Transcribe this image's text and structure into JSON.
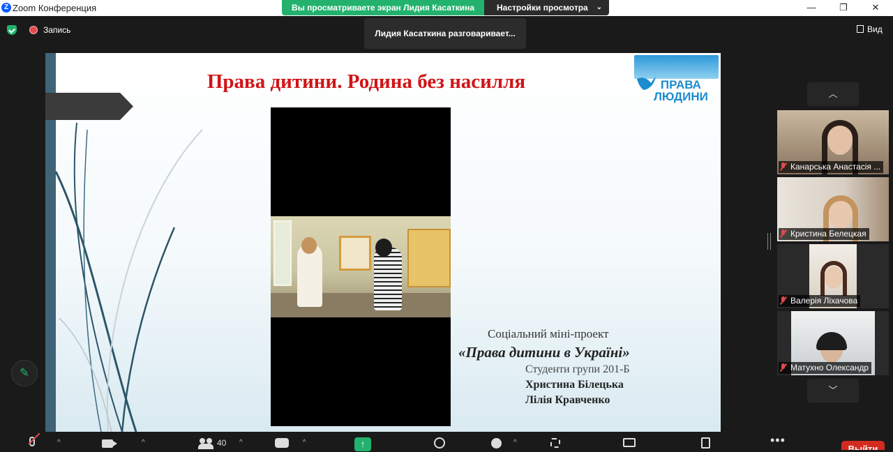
{
  "window": {
    "title": "Zoom Конференция",
    "logo_letter": "Z",
    "controls": {
      "minimize": "—",
      "maximize": "❐",
      "close": "✕"
    }
  },
  "share_banner": {
    "viewing_text": "Вы просматриваете экран Лидия Касаткина",
    "view_options_label": "Настройки просмотра",
    "chevron": "⌄"
  },
  "top_bar": {
    "record_label": "Запись",
    "view_label": "Вид"
  },
  "speaking_indicator": "Лидия Касаткина разговаривает...",
  "slide": {
    "title": "Права дитини. Родина без насилля",
    "logo_line1": "ПРАВА",
    "logo_line2": "ЛЮДИНИ",
    "caption_line1": "Соціальний міні-проект",
    "caption_line2": "«Права дитини в Україні»",
    "caption_line3": "Студенти групи 201-Б",
    "caption_line4": "Христина Білецька",
    "caption_line5": "Лілія Кравченко"
  },
  "annotate_button_glyph": "✎",
  "gallery": {
    "scroll_up": "︿",
    "scroll_down": "﹀",
    "participants": [
      {
        "name": "Канарська Анастасія ...",
        "muted": true
      },
      {
        "name": "Кристина Белецкая",
        "muted": true
      },
      {
        "name": "Валерія Ліхачова",
        "muted": true
      },
      {
        "name": "Матухно Олександр",
        "muted": true
      }
    ]
  },
  "toolbar": {
    "participants_count": "40",
    "caret": "^",
    "share_arrow": "↑",
    "more": "•••",
    "leave_label": "Выйти"
  },
  "colors": {
    "zoom_green": "#23b26d",
    "zoom_blue": "#0b5cff",
    "slide_title_red": "#d01418",
    "leave_red": "#d52b1e"
  }
}
